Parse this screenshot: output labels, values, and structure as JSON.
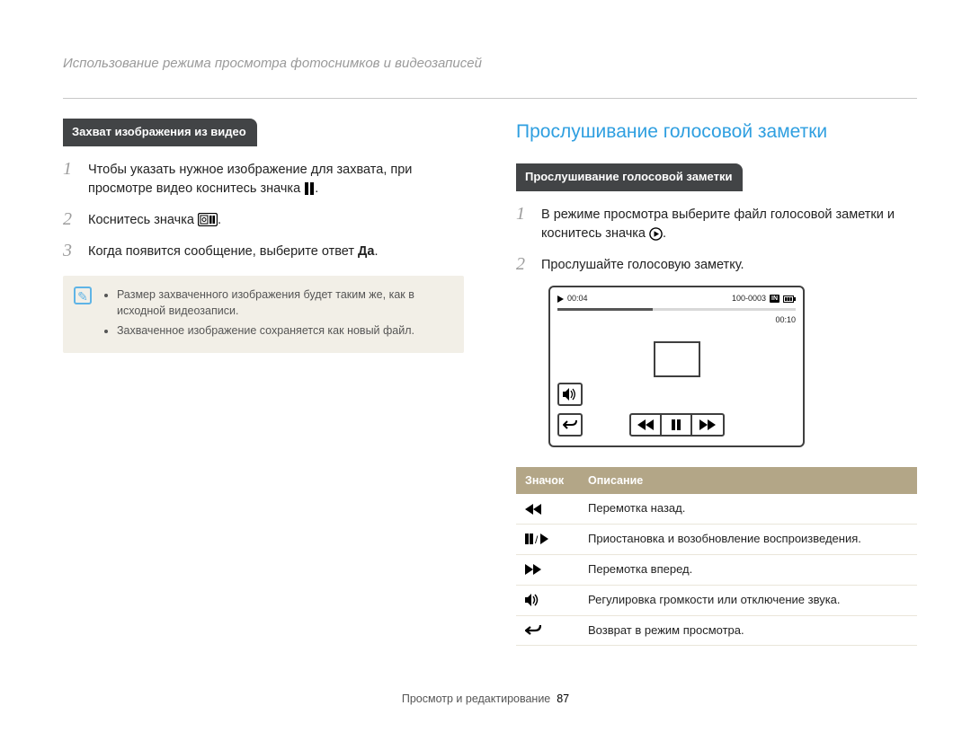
{
  "header": "Использование режима просмотра фотоснимков и видеозаписей",
  "left": {
    "tab": "Захват изображения из видео",
    "steps": [
      {
        "n": "1",
        "text_pre": "Чтобы указать нужное изображение для захвата, при просмотре видео коснитесь значка ",
        "icon": "pause",
        "text_post": "."
      },
      {
        "n": "2",
        "text_pre": "Коснитесь значка ",
        "icon": "capture",
        "text_post": "."
      },
      {
        "n": "3",
        "text_pre": "Когда появится сообщение, выберите ответ ",
        "bold": "Да",
        "text_post": "."
      }
    ],
    "note": [
      "Размер захваченного изображения будет таким же, как в исходной видеозаписи.",
      "Захваченное изображение сохраняется как новый файл."
    ]
  },
  "right": {
    "title": "Прослушивание голосовой заметки",
    "tab": "Прослушивание голосовой заметки",
    "steps": [
      {
        "n": "1",
        "text_pre": "В режиме просмотра выберите файл голосовой заметки и коснитесь значка ",
        "icon": "play-circle",
        "text_post": "."
      },
      {
        "n": "2",
        "text_pre": "Прослушайте голосовую заметку.",
        "text_post": ""
      }
    ],
    "player": {
      "elapsed": "00:04",
      "total": "00:10",
      "file_id": "100-0003",
      "storage": "IN"
    },
    "table": {
      "head_icon": "Значок",
      "head_desc": "Описание",
      "rows": [
        {
          "icon": "rewind-icon",
          "desc": "Перемотка назад."
        },
        {
          "icon": "pause-play-icon",
          "desc": "Приостановка и возобновление воспроизведения."
        },
        {
          "icon": "forward-icon",
          "desc": "Перемотка вперед."
        },
        {
          "icon": "volume-icon",
          "desc": "Регулировка громкости или отключение звука."
        },
        {
          "icon": "return-icon",
          "desc": "Возврат в режим просмотра."
        }
      ]
    }
  },
  "footer": {
    "section": "Просмотр и редактирование",
    "page": "87"
  }
}
